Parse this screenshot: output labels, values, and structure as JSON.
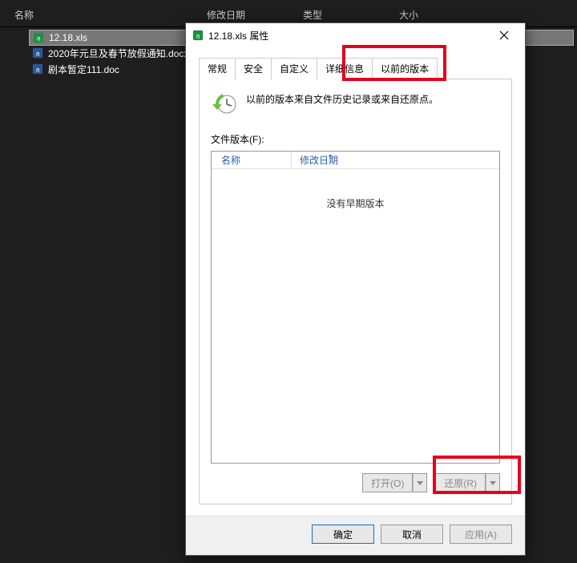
{
  "explorer": {
    "columns": {
      "name": "名称",
      "date": "修改日期",
      "type": "类型",
      "size": "大小"
    },
    "files": [
      {
        "name": "12.18.xls",
        "icon": "xls"
      },
      {
        "name": "2020年元旦及春节放假通知.docx",
        "icon": "docx"
      },
      {
        "name": "剧本暂定111.doc",
        "icon": "doc"
      }
    ]
  },
  "dialog": {
    "title": "12.18.xls 属性",
    "tabs": {
      "general": "常规",
      "security": "安全",
      "custom": "自定义",
      "details": "详细信息",
      "previous": "以前的版本"
    },
    "desc": "以前的版本来自文件历史记录或来自还原点。",
    "list_label": "文件版本(F):",
    "list_head": {
      "name": "名称",
      "date": "修改日期"
    },
    "empty": "没有早期版本",
    "actions": {
      "open": "打开(O)",
      "restore": "还原(R)"
    },
    "footer": {
      "ok": "确定",
      "cancel": "取消",
      "apply": "应用(A)"
    }
  }
}
